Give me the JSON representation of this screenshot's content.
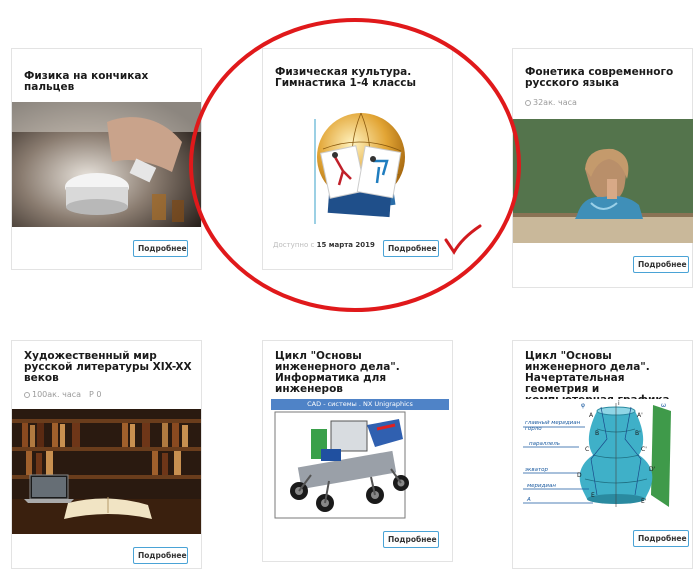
{
  "cards": [
    {
      "title": "Физика на кончиках пальцев",
      "button": "Подробнее"
    },
    {
      "title": "Физическая культура. Гимнастика 1-4 классы",
      "date_prefix": "Доступно с",
      "date": "15 марта 2019",
      "button": "Подробнее"
    },
    {
      "title": "Фонетика современного русского языка",
      "hours": "32ак. часа",
      "button": "Подробнее"
    },
    {
      "title": "Художественный мир русской литературы XIX-XX веков",
      "hours": "100ак. часа",
      "points": "Р 0",
      "button": "Подробнее"
    },
    {
      "title": "Цикл \"Основы инженерного дела\". Информатика для инженеров",
      "image_caption": "CAD - системы . NX Unigraphics",
      "button": "Подробнее"
    },
    {
      "title": "Цикл \"Основы инженерного дела\". Начертательная геометрия и компьютерная графика",
      "button": "Подробнее",
      "diagram_labels": [
        "главный меридиан",
        "горло",
        "параллель",
        "экватор",
        "меридиан",
        "A",
        "A'",
        "B",
        "B'",
        "C",
        "C'",
        "D",
        "D'",
        "E",
        "E'",
        "φ",
        "ω",
        "i"
      ]
    }
  ],
  "colors": {
    "highlight_circle": "#e0191b",
    "checkmark": "#d11a1e",
    "button_border": "#4aa3d6"
  }
}
